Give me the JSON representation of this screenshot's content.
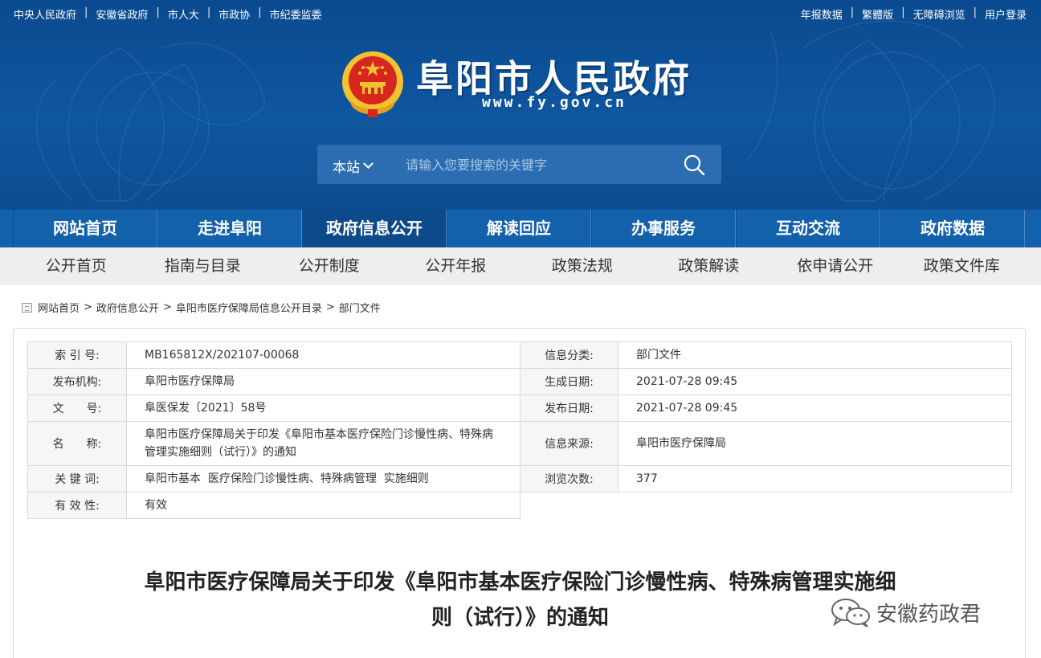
{
  "topbar": {
    "left_links": [
      "中央人民政府",
      "安徽省政府",
      "市人大",
      "市政协",
      "市纪委监委"
    ],
    "right_links": [
      "年报数据",
      "繁體版",
      "无障碍浏览",
      "用户登录"
    ]
  },
  "header": {
    "site_title": "阜阳市人民政府",
    "site_url": "www.fy.gov.cn"
  },
  "search": {
    "scope_label": "本站",
    "placeholder": "请输入您要搜索的关键字"
  },
  "main_nav": {
    "tabs": [
      "网站首页",
      "走进阜阳",
      "政府信息公开",
      "解读回应",
      "办事服务",
      "互动交流",
      "政府数据"
    ],
    "active_index": 2
  },
  "sub_nav": {
    "items": [
      "公开首页",
      "指南与目录",
      "公开制度",
      "公开年报",
      "政策法规",
      "政策解读",
      "依申请公开",
      "政策文件库"
    ]
  },
  "breadcrumb": {
    "items": [
      "网站首页",
      "政府信息公开",
      "阜阳市医疗保障局信息公开目录",
      "部门文件"
    ]
  },
  "meta": {
    "index_label": "索 引 号:",
    "index_value": "MB165812X/202107-00068",
    "category_label": "信息分类:",
    "category_value": "部门文件",
    "publisher_label": "发布机构:",
    "publisher_value": "阜阳市医疗保障局",
    "created_label": "生成日期:",
    "created_value": "2021-07-28 09:45",
    "docno_label": "文　　号:",
    "docno_value": "阜医保发〔2021〕58号",
    "published_label": "发布日期:",
    "published_value": "2021-07-28 09:45",
    "name_label": "名　　称:",
    "name_value": "阜阳市医疗保障局关于印发《阜阳市基本医疗保险门诊慢性病、特殊病管理实施细则（试行）》的通知",
    "source_label": "信息来源:",
    "source_value": "阜阳市医疗保障局",
    "keywords_label": "关 键 词:",
    "keywords_value": "阜阳市基本  医疗保险门诊慢性病、特殊病管理  实施细则",
    "views_label": "浏览次数:",
    "views_value": "377",
    "validity_label": "有 效 性:",
    "validity_value": "有效"
  },
  "document": {
    "title_line1": "阜阳市医疗保障局关于印发《阜阳市基本医疗保险门诊慢性病、特殊病管理实施细",
    "title_line2": "则（试行）》的通知"
  },
  "watermark": {
    "text": "安徽药政君"
  },
  "colors": {
    "header_blue": "#0e569f",
    "nav_blue": "#1360ab",
    "nav_active": "#0c4a8a",
    "subnav_bg": "#eeeeee",
    "emblem_red": "#d7261e",
    "emblem_gold": "#f2c230"
  }
}
